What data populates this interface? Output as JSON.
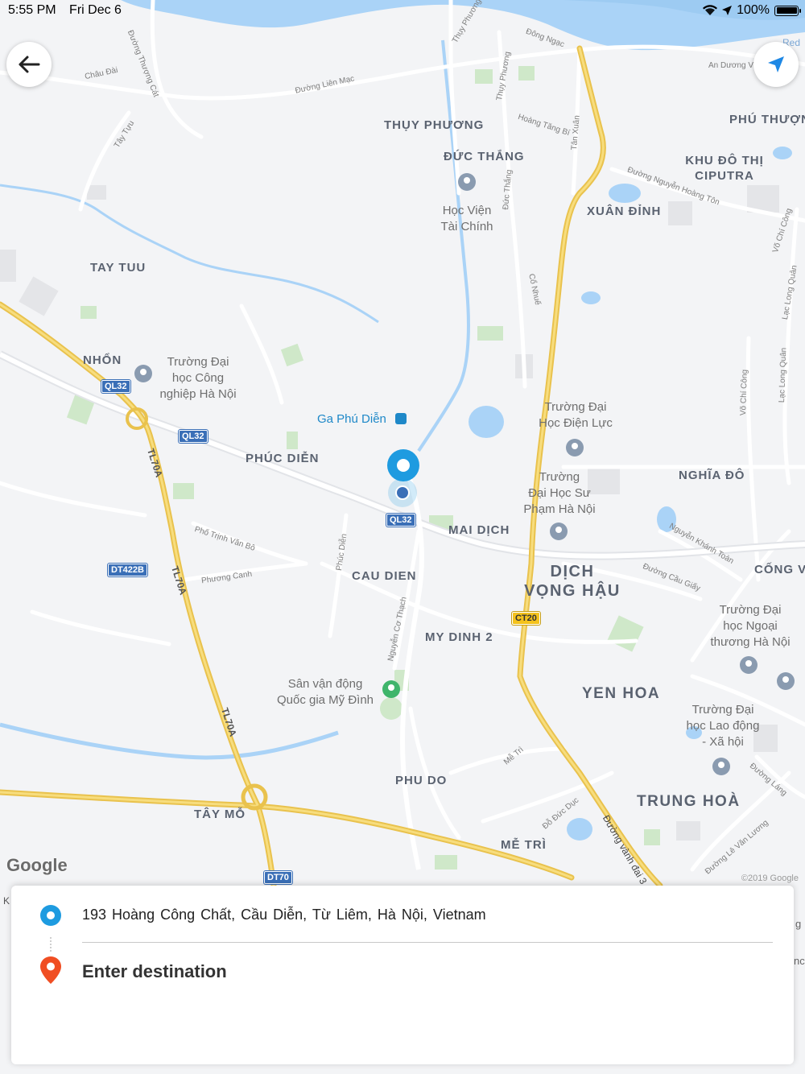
{
  "status_bar": {
    "time": "5:55 PM",
    "date": "Fri Dec 6",
    "battery": "100%",
    "icons": [
      "wifi-icon",
      "location-arrow-icon",
      "battery-icon"
    ]
  },
  "nav": {
    "back_icon": "arrow-left-icon",
    "locate_icon": "navigation-arrow-icon"
  },
  "colors": {
    "accent_blue": "#1e9be0",
    "destination_pin": "#f04e23",
    "water": "#aad3f7",
    "highway": "#f4cf58"
  },
  "map": {
    "districts": [
      {
        "id": "thuy-phuong",
        "label": "THỤY PHƯƠNG"
      },
      {
        "id": "duc-thang",
        "label": "ĐỨC THẮNG"
      },
      {
        "id": "phu-thuong",
        "label": "PHÚ THƯỢNG"
      },
      {
        "id": "khu-do-thi-ciputra",
        "label": "KHU ĐÔ THỊ CIPUTRA"
      },
      {
        "id": "xuan-dinh",
        "label": "XUÂN ĐỈNH"
      },
      {
        "id": "tay-tuu",
        "label": "TAY TUU"
      },
      {
        "id": "nhon",
        "label": "NHỔN"
      },
      {
        "id": "phuc-dien",
        "label": "PHÚC DIỄN"
      },
      {
        "id": "nghia-do",
        "label": "NGHĨA ĐÔ"
      },
      {
        "id": "mai-dich",
        "label": "MAI DỊCH"
      },
      {
        "id": "cau-dien",
        "label": "CAU DIEN"
      },
      {
        "id": "cong-vi",
        "label": "CỐNG V"
      },
      {
        "id": "my-dinh-2",
        "label": "MY DINH 2"
      },
      {
        "id": "yen-hoa",
        "label": "YEN HOA"
      },
      {
        "id": "phu-do",
        "label": "PHU DO"
      },
      {
        "id": "trung-hoa",
        "label": "TRUNG HOÀ"
      },
      {
        "id": "tay-mo",
        "label": "TÂY MỖ"
      },
      {
        "id": "me-tri",
        "label": "MỄ TRÌ"
      }
    ],
    "large_districts": [
      {
        "id": "dich-vong-hau",
        "line1": "DỊCH",
        "line2": "VỌNG HẬU"
      }
    ],
    "pois": [
      {
        "id": "hoc-vien-tai-chinh",
        "lines": [
          "Học Viện",
          "Tài Chính"
        ]
      },
      {
        "id": "dh-cong-nghiep",
        "lines": [
          "Trường Đại",
          "học Công",
          "nghiệp Hà Nội"
        ]
      },
      {
        "id": "dh-dien-luc",
        "lines": [
          "Trường Đại",
          "Học Điện Lực"
        ]
      },
      {
        "id": "dh-su-pham",
        "lines": [
          "Trường",
          "Đại Học Sư",
          "Phạm Hà Nội"
        ]
      },
      {
        "id": "dh-ngoai-thuong",
        "lines": [
          "Trường Đại",
          "học Ngoại",
          "thương Hà Nội"
        ]
      },
      {
        "id": "san-my-dinh",
        "lines": [
          "Sân vận động",
          "Quốc gia Mỹ Đình"
        ]
      },
      {
        "id": "dh-lao-dong",
        "lines": [
          "Trường Đại",
          "học Lao động",
          "- Xã hội"
        ]
      }
    ],
    "transit": {
      "label": "Ga Phú Diễn"
    },
    "roads": [
      {
        "id": "duong-thuong-cat",
        "label": "Đường Thượng Cát"
      },
      {
        "id": "chau-dai",
        "label": "Châu Đài"
      },
      {
        "id": "duong-lien-mac",
        "label": "Đường Liên Mạc"
      },
      {
        "id": "thuy-phuong-1",
        "label": "Thụy Phương"
      },
      {
        "id": "dong-ngac",
        "label": "Đông Ngạc"
      },
      {
        "id": "an-duong-v",
        "label": "An Dương V"
      },
      {
        "id": "thuy-phuong-2",
        "label": "Thụy Phương"
      },
      {
        "id": "hoang-tang-bi",
        "label": "Hoàng Tăng Bí"
      },
      {
        "id": "tan-xuan",
        "label": "Tân Xuân"
      },
      {
        "id": "tay-tuu-road",
        "label": "Tây Tựu"
      },
      {
        "id": "duc-thang-road",
        "label": "Đức Thắng"
      },
      {
        "id": "nguyen-hoang-ton",
        "label": "Đường Nguyễn Hoàng Tôn"
      },
      {
        "id": "vo-chi-cong-1",
        "label": "Võ Chí Công"
      },
      {
        "id": "lac-long-quan-1",
        "label": "Lạc Long Quân"
      },
      {
        "id": "co-nhue",
        "label": "Cổ Nhuế"
      },
      {
        "id": "vo-chi-cong-2",
        "label": "Võ Chí Công"
      },
      {
        "id": "lac-long-quan-2",
        "label": "Lạc Long Quân"
      },
      {
        "id": "tl70a-1",
        "label": "TL70A"
      },
      {
        "id": "pho-trinh-van-bo",
        "label": "Phố Trịnh Văn Bô"
      },
      {
        "id": "tl70a-2",
        "label": "TL70A"
      },
      {
        "id": "phuong-canh",
        "label": "Phương Canh"
      },
      {
        "id": "phuc-dien-road",
        "label": "Phúc Diễn"
      },
      {
        "id": "nguyen-co-thach",
        "label": "Nguyễn Cơ Thạch"
      },
      {
        "id": "nguyen-khanh-toan",
        "label": "Nguyễn Khánh Toàn"
      },
      {
        "id": "duong-cau-giay",
        "label": "Đường Cầu Giấy"
      },
      {
        "id": "tl70a-3",
        "label": "TL70A"
      },
      {
        "id": "me-tri-road",
        "label": "Mễ Trì"
      },
      {
        "id": "do-duc-duc",
        "label": "Đỗ Đức Dục"
      },
      {
        "id": "duong-vanh-dai-3",
        "label": "Đường vành đai 3"
      },
      {
        "id": "duong-lang",
        "label": "Đường Láng"
      },
      {
        "id": "le-van-luong",
        "label": "Đường Lê Văn Lương"
      },
      {
        "id": "red-river",
        "label": "Red"
      }
    ],
    "shields": [
      {
        "id": "ql32-a",
        "label": "QL32",
        "style": "blue"
      },
      {
        "id": "ql32-b",
        "label": "QL32",
        "style": "blue"
      },
      {
        "id": "ql32-c",
        "label": "QL32",
        "style": "blue"
      },
      {
        "id": "dt422b",
        "label": "DT422B",
        "style": "blue"
      },
      {
        "id": "ct20",
        "label": "CT20",
        "style": "yellow"
      },
      {
        "id": "dt70",
        "label": "DT70",
        "style": "blue"
      }
    ],
    "google_logo": "Google",
    "copyright": "©2019 Google",
    "right_edge": {
      "k": "K",
      "g": "g",
      "nc": "nc"
    }
  },
  "panel": {
    "origin_address": "193 Hoàng Công Chất,  Cầu Diễn,  Từ Liêm,  Hà Nội,  Vietnam",
    "destination_placeholder": "Enter destination"
  }
}
